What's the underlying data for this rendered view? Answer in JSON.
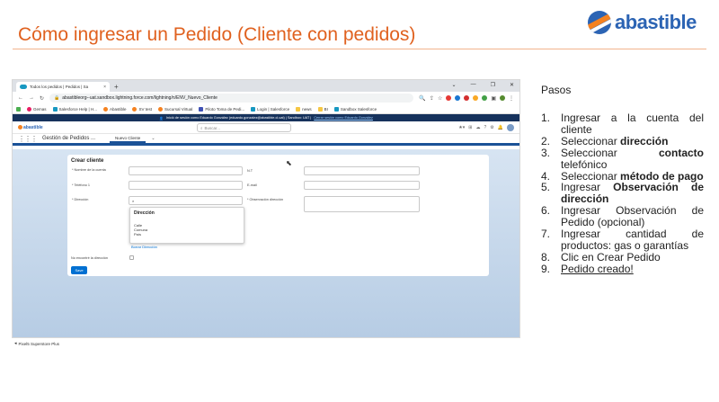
{
  "slide": {
    "title": "Cómo ingresar un Pedido (Cliente con pedidos)",
    "logo_text": "abastible",
    "accent_color": "#e0611f",
    "logo_color": "#2c64b4"
  },
  "browser": {
    "tab_title": "Todos los pedidos | Pedidos | Sa",
    "tab_close": "×",
    "new_tab": "+",
    "url": "abastibleorg--uat.sandbox.lightning.force.com/lightning/n/ENV_Nuevo_Cliente",
    "bookmarks": [
      "Gemas",
      "Salesforce Help | H...",
      "Abastible",
      "SV test",
      "Sucursal Virtual",
      "Piloto Toma de Pedi...",
      "Login | Salesforce",
      "news",
      "BI",
      "Sandbox Salesforce"
    ]
  },
  "sandbox_bar": {
    "text": "Inició de sesión como Eduardo González (eduardo.gonzalez@abastible.cl.uat) | Sandbox: UAT |",
    "link": "Cerrar sesión como Eduardo González"
  },
  "sf": {
    "logo_text": "abastible",
    "search_placeholder": "Buscar...",
    "app_name": "Gestión de Pedidos ...",
    "nav_tab": "Nuevo Cliente"
  },
  "form": {
    "title": "Crear cliente",
    "nombre_label": "* Nombre de la cuenta",
    "rut_label": "N.T",
    "telefono_label": "* Teléfono 1",
    "email_label": "E-mail",
    "direccion_label": "* Dirección",
    "obs_label": "* Observación dirección",
    "search_icon": "search-icon",
    "dropdown_title": "Dirección",
    "dropdown_options": [
      "Calle",
      "Comuna",
      "País"
    ],
    "borrar_link": "Borrar Dirección",
    "no_encontre_label": "No encontré la dirección",
    "save_button": "Save"
  },
  "footnote": "Pixel5 Superstore Plus",
  "steps": {
    "title": "Pasos",
    "items": [
      {
        "n": "1.",
        "parts": [
          {
            "t": "Ingresar a la cuenta del cliente",
            "s": ""
          }
        ]
      },
      {
        "n": "2.",
        "parts": [
          {
            "t": "Seleccionar ",
            "s": ""
          },
          {
            "t": "dirección",
            "s": "b"
          }
        ]
      },
      {
        "n": "3.",
        "parts": [
          {
            "t": "Seleccionar ",
            "s": ""
          },
          {
            "t": "contacto",
            "s": "b"
          },
          {
            "t": " telefónico",
            "s": ""
          }
        ]
      },
      {
        "n": "4.",
        "parts": [
          {
            "t": "Seleccionar ",
            "s": ""
          },
          {
            "t": "método de pago",
            "s": "b"
          }
        ]
      },
      {
        "n": "5.",
        "parts": [
          {
            "t": "Ingresar ",
            "s": ""
          },
          {
            "t": "Observación de dirección",
            "s": "b"
          }
        ]
      },
      {
        "n": "6.",
        "parts": [
          {
            "t": "Ingresar Observación de Pedido (opcional)",
            "s": ""
          }
        ]
      },
      {
        "n": "7.",
        "parts": [
          {
            "t": "Ingresar cantidad de productos: gas o garantías",
            "s": ""
          }
        ]
      },
      {
        "n": "8.",
        "parts": [
          {
            "t": "Clic en Crear Pedido",
            "s": ""
          }
        ]
      },
      {
        "n": "9.",
        "parts": [
          {
            "t": "Pedido creado!",
            "s": "u"
          }
        ]
      }
    ]
  }
}
